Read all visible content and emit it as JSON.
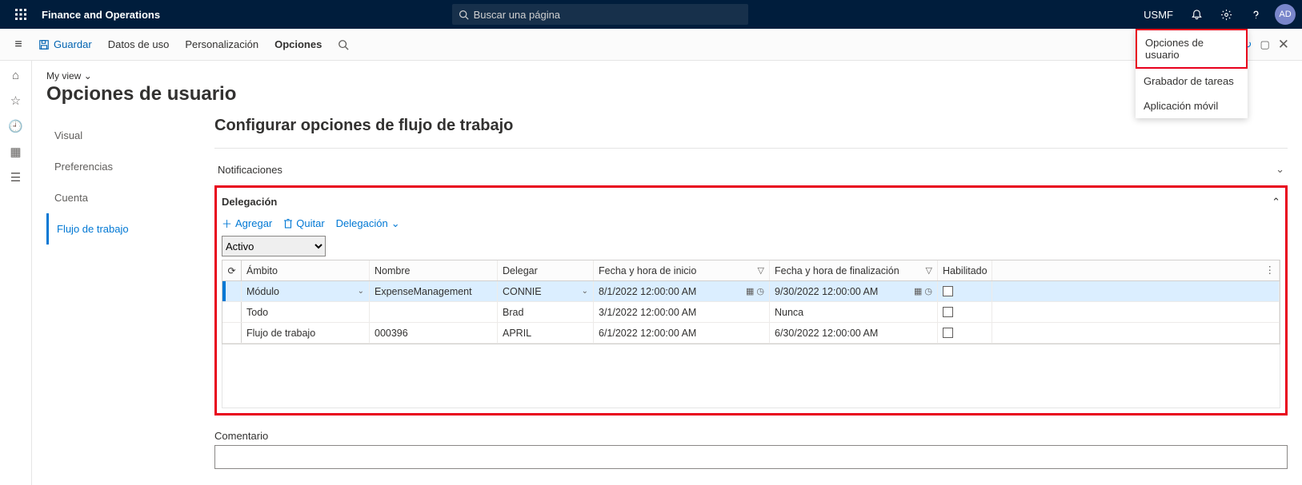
{
  "header": {
    "app_title": "Finance and Operations",
    "search_placeholder": "Buscar una página",
    "company": "USMF",
    "avatar_initials": "AD"
  },
  "settings_menu": {
    "items": [
      "Opciones de usuario",
      "Grabador de tareas",
      "Aplicación móvil"
    ]
  },
  "action_bar": {
    "save": "Guardar",
    "usage": "Datos de uso",
    "personalization": "Personalización",
    "options": "Opciones"
  },
  "page": {
    "my_view": "My view",
    "title": "Opciones de usuario"
  },
  "tabs": {
    "visual": "Visual",
    "preferences": "Preferencias",
    "account": "Cuenta",
    "workflow": "Flujo de trabajo"
  },
  "workflow": {
    "section_title": "Configurar opciones de flujo de trabajo",
    "notifications_label": "Notificaciones",
    "delegation_label": "Delegación",
    "toolbar": {
      "add": "Agregar",
      "remove": "Quitar",
      "delegation": "Delegación"
    },
    "filter_value": "Activo",
    "columns": {
      "ambito": "Ámbito",
      "nombre": "Nombre",
      "delegar": "Delegar",
      "inicio": "Fecha y hora de inicio",
      "fin": "Fecha y hora de finalización",
      "habilitado": "Habilitado"
    },
    "rows": [
      {
        "ambito": "Módulo",
        "nombre": "ExpenseManagement",
        "delegar": "CONNIE",
        "inicio": "8/1/2022 12:00:00 AM",
        "fin": "9/30/2022 12:00:00 AM",
        "habilitado": false,
        "selected": true
      },
      {
        "ambito": "Todo",
        "nombre": "",
        "delegar": "Brad",
        "inicio": "3/1/2022 12:00:00 AM",
        "fin": "Nunca",
        "habilitado": false,
        "selected": false
      },
      {
        "ambito": "Flujo de trabajo",
        "nombre": "000396",
        "delegar": "APRIL",
        "inicio": "6/1/2022 12:00:00 AM",
        "fin": "6/30/2022 12:00:00 AM",
        "habilitado": false,
        "selected": false
      }
    ],
    "comment_label": "Comentario"
  }
}
